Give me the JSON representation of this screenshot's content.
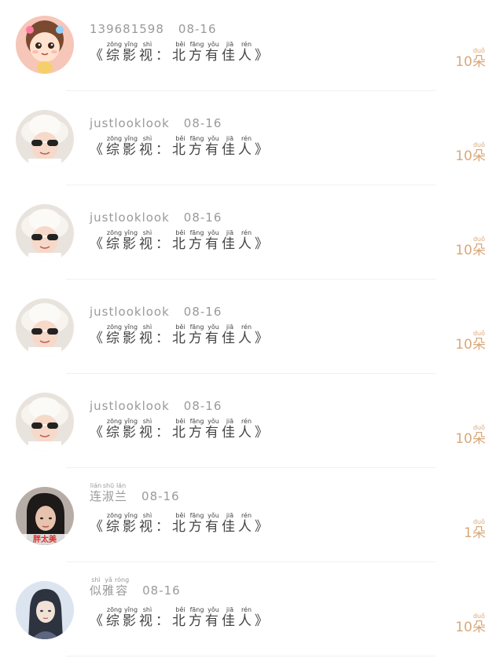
{
  "title_ruby": [
    {
      "c": "《",
      "r": ""
    },
    {
      "c": "综",
      "r": "zōng"
    },
    {
      "c": "影",
      "r": "yǐng"
    },
    {
      "c": "视",
      "r": "shì"
    },
    {
      "c": "：",
      "r": ""
    },
    {
      "c": "北",
      "r": "běi"
    },
    {
      "c": "方",
      "r": "fāng"
    },
    {
      "c": "有",
      "r": "yǒu"
    },
    {
      "c": "佳",
      "r": "jiā"
    },
    {
      "c": "人",
      "r": "rén"
    },
    {
      "c": "》",
      "r": ""
    }
  ],
  "unit": {
    "char": "朵",
    "ruby": "duǒ"
  },
  "rows": [
    {
      "name": "139681598",
      "date": "08-16",
      "count": "10",
      "avatar": "cartoon-girl"
    },
    {
      "name": "justlooklook",
      "date": "08-16",
      "count": "10",
      "avatar": "girl-white-hat"
    },
    {
      "name": "justlooklook",
      "date": "08-16",
      "count": "10",
      "avatar": "girl-white-hat"
    },
    {
      "name": "justlooklook",
      "date": "08-16",
      "count": "10",
      "avatar": "girl-white-hat"
    },
    {
      "name": "justlooklook",
      "date": "08-16",
      "count": "10",
      "avatar": "girl-white-hat"
    },
    {
      "name_ruby": [
        {
          "c": "连",
          "r": "lián"
        },
        {
          "c": "淑",
          "r": "shū"
        },
        {
          "c": "兰",
          "r": "lán"
        }
      ],
      "date": "08-16",
      "count": "1",
      "avatar": "woman-dark-hair",
      "avatar_caption": "胖太美"
    },
    {
      "name_ruby": [
        {
          "c": "似",
          "r": "shì"
        },
        {
          "c": "雅",
          "r": "yǎ"
        },
        {
          "c": "容",
          "r": "róng"
        }
      ],
      "date": "08-16",
      "count": "10",
      "avatar": "anime-man"
    }
  ]
}
